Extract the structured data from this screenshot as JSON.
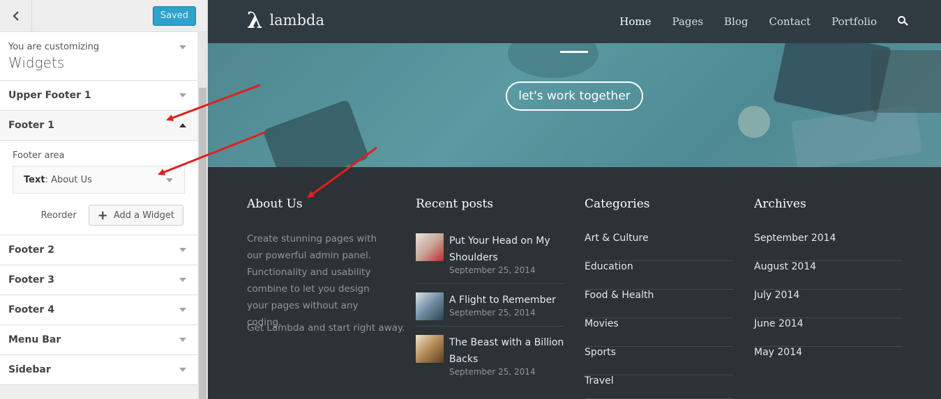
{
  "customizer": {
    "saved_label": "Saved",
    "customizing_label": "You are customizing",
    "customizing_title": "Widgets",
    "sections": {
      "upper_footer_1": "Upper Footer 1",
      "footer_1": "Footer 1",
      "footer_2": "Footer 2",
      "footer_3": "Footer 3",
      "footer_4": "Footer 4",
      "menu_bar": "Menu Bar",
      "sidebar": "Sidebar"
    },
    "footer_1_panel": {
      "area_label": "Footer area",
      "widget_type": "Text",
      "widget_title": ": About Us",
      "reorder_label": "Reorder",
      "add_widget_label": "Add a Widget"
    }
  },
  "site": {
    "logo_symbol": "λ",
    "logo_name": "lambda",
    "nav": [
      "Home",
      "Pages",
      "Blog",
      "Contact",
      "Portfolio"
    ],
    "hero_button": "let's work together",
    "footer": {
      "about": {
        "title": "About Us",
        "text": "Create stunning pages with our powerful admin panel. Functionality and usability combine to let you design your pages without any coding.",
        "cta": "Get Lambda and start right away."
      },
      "recent_posts": {
        "title": "Recent posts",
        "items": [
          {
            "title": "Put Your Head on My Shoulders",
            "date": "September 25, 2014"
          },
          {
            "title": "A Flight to Remember",
            "date": "September 25, 2014"
          },
          {
            "title": "The Beast with a Billion Backs",
            "date": "September 25, 2014"
          }
        ]
      },
      "categories": {
        "title": "Categories",
        "items": [
          "Art & Culture",
          "Education",
          "Food & Health",
          "Movies",
          "Sports",
          "Travel"
        ]
      },
      "archives": {
        "title": "Archives",
        "items": [
          "September 2014",
          "August 2014",
          "July 2014",
          "June 2014",
          "May 2014"
        ]
      }
    }
  },
  "colors": {
    "saved_button": "#2ea2cc",
    "navbar": "#2f3b40",
    "hero": "#5b9aa2",
    "footer": "#2c3235",
    "arrows": "#e02020"
  }
}
